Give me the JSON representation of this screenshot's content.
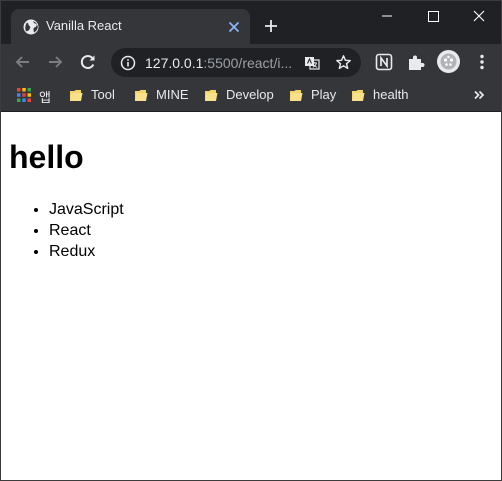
{
  "tab": {
    "title": "Vanilla React"
  },
  "toolbar": {
    "url_host": "127.0.0.1",
    "url_rest": ":5500/react/i..."
  },
  "bookmarks": {
    "apps_label": "앱",
    "items": [
      {
        "label": "Tool"
      },
      {
        "label": "MINE"
      },
      {
        "label": "Develop"
      },
      {
        "label": "Play"
      },
      {
        "label": "health"
      }
    ]
  },
  "page": {
    "heading": "hello",
    "list": [
      "JavaScript",
      "React",
      "Redux"
    ]
  },
  "colors": {
    "tab_title": "#e8eaed",
    "tabstrip_bg": "#202124",
    "toolbar_bg": "#35363a",
    "folder": "#f5d56a",
    "tab_close": "#8ab4f8"
  },
  "icons": {
    "favicon": "globe-icon",
    "tab_close": "close-icon",
    "new_tab": "plus-icon",
    "back": "back-arrow-icon",
    "forward": "forward-arrow-icon",
    "reload": "reload-icon",
    "info": "info-icon",
    "translate": "translate-icon",
    "bookmark_star": "star-icon",
    "notion": "notion-icon",
    "extensions": "puzzle-icon",
    "profile": "avatar",
    "menu": "kebab-menu-icon",
    "apps": "apps-grid-icon",
    "folder": "folder-icon",
    "more": "double-chevron-icon"
  }
}
